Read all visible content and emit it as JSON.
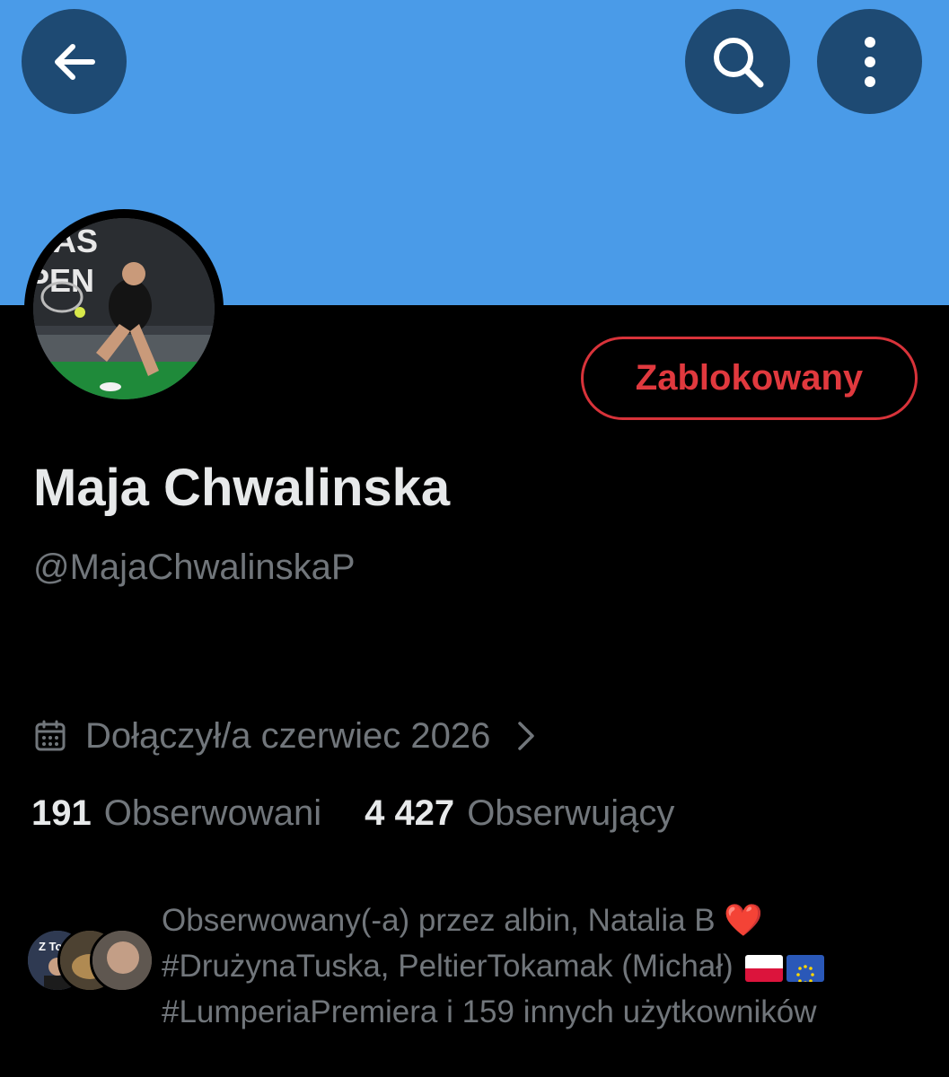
{
  "header": {
    "back_icon": "arrow-left-icon",
    "search_icon": "search-icon",
    "more_icon": "more-vertical-icon"
  },
  "profile": {
    "avatar_text_line1": "RAS",
    "avatar_text_line2": "PEN",
    "block_button_label": "Zablokowany",
    "display_name": "Maja Chwalinska",
    "handle": "@MajaChwalinskaP",
    "joined_icon": "calendar-icon",
    "joined_text": "Dołączył/a czerwiec 2026",
    "following_count": "191",
    "following_label": "Obserwowani",
    "followers_count": "4 427",
    "followers_label": "Obserwujący"
  },
  "followed_by": {
    "line1": "Obserwowany(-a) przez albin, Natalia B ",
    "heart": "❤️",
    "line2": "#DrużynaTuska, PeltierTokamak (Michał) ",
    "flags": [
      "flag-poland",
      "flag-eu"
    ],
    "line3": "#LumperiaPremiera i 159 innych użytkowników",
    "avatar_text": "Z Tobą"
  },
  "colors": {
    "banner": "#4a9be8",
    "header_button": "#1e4a73",
    "block_red": "#e0393e",
    "muted_text": "#71767b"
  }
}
